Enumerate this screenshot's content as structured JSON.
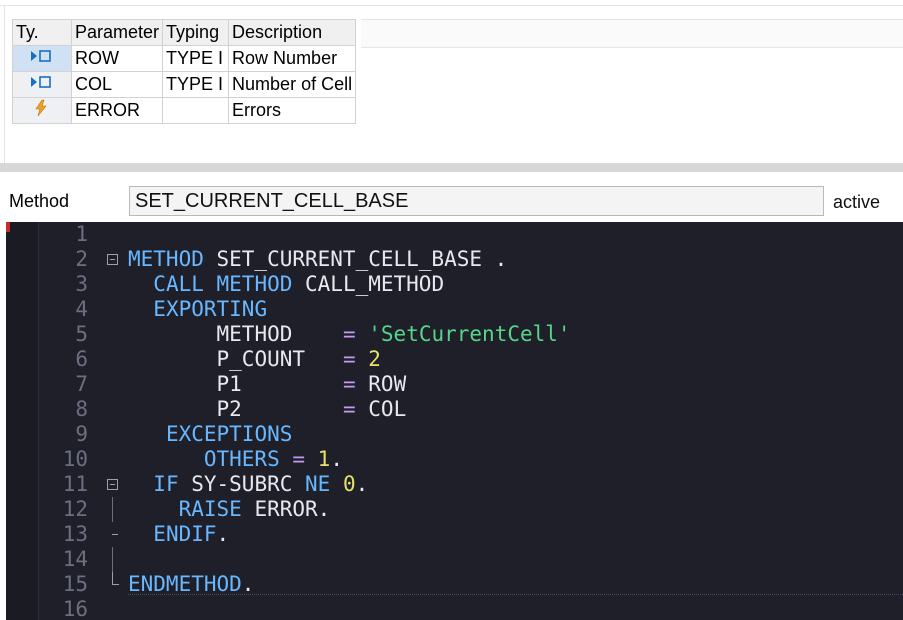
{
  "param_table": {
    "headers": {
      "type": "Ty.",
      "parameter": "Parameter",
      "typing": "Typing",
      "description": "Description"
    },
    "rows": [
      {
        "icon": "importing-param-icon",
        "parameter": "ROW",
        "typing": "TYPE I",
        "description": "Row Number"
      },
      {
        "icon": "importing-param-icon",
        "parameter": "COL",
        "typing": "TYPE I",
        "description": "Number of Cell"
      },
      {
        "icon": "exception-lightning-icon",
        "parameter": "ERROR",
        "typing": "",
        "description": "Errors"
      }
    ]
  },
  "method_bar": {
    "label": "Method",
    "value": "SET_CURRENT_CELL_BASE",
    "status": "active"
  },
  "editor": {
    "line_numbers": [
      "1",
      "2",
      "3",
      "4",
      "5",
      "6",
      "7",
      "8",
      "9",
      "10",
      "11",
      "12",
      "13",
      "14",
      "15",
      "16"
    ],
    "code": {
      "l2_kw": "METHOD",
      "l2_name": " SET_CURRENT_CELL_BASE",
      "l2_end": " .",
      "l3_kw1": "CALL METHOD",
      "l3_name": " CALL_METHOD",
      "l4_kw": "EXPORTING",
      "l5_name": "METHOD",
      "l5_op": "=",
      "l5_val": "'SetCurrentCell'",
      "l6_name": "P_COUNT",
      "l6_op": "=",
      "l6_val": "2",
      "l7_name": "P1",
      "l7_op": "=",
      "l7_val": "ROW",
      "l8_name": "P2",
      "l8_op": "=",
      "l8_val": "COL",
      "l9_kw": "EXCEPTIONS",
      "l10_kw": "OTHERS",
      "l10_op": " =",
      "l10_val": " 1",
      "l10_end": ".",
      "l11_kw1": "IF",
      "l11_name": " SY-SUBRC",
      "l11_kw2": " NE",
      "l11_val": " 0",
      "l11_end": ".",
      "l12_kw": "RAISE",
      "l12_name": " ERROR",
      "l12_end": ".",
      "l13_kw": "ENDIF",
      "l13_end": ".",
      "l15_kw": "ENDMETHOD",
      "l15_end": "."
    }
  }
}
